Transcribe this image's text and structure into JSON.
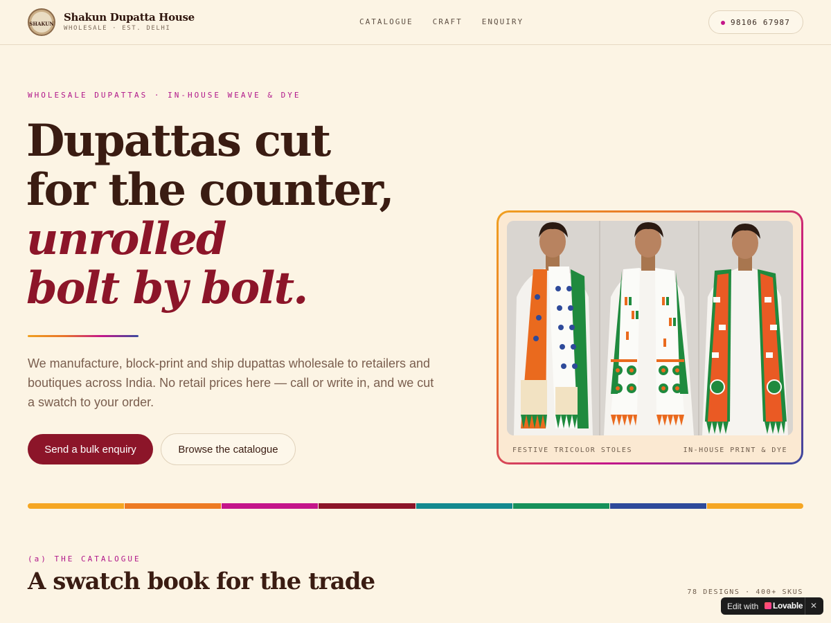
{
  "header": {
    "logo_text": "SHAKUN",
    "brand_name": "Shakun Dupatta House",
    "brand_tagline": "WHOLESALE · EST. DELHI",
    "nav": [
      {
        "label": "CATALOGUE"
      },
      {
        "label": "CRAFT"
      },
      {
        "label": "ENQUIRY"
      }
    ],
    "phone": "98106 67987"
  },
  "hero": {
    "eyebrow": "WHOLESALE DUPATTAS · IN-HOUSE WEAVE & DYE",
    "headline_lines": [
      "Dupattas cut",
      "for the counter,",
      "unrolled",
      "bolt by bolt."
    ],
    "lede": "We manufacture, block-print and ship dupattas wholesale to retailers and boutiques across India. No retail prices here — call or write in, and we cut a swatch to your order.",
    "primary_cta": "Send a bulk enquiry",
    "secondary_cta": "Browse the catalogue",
    "image_caption_left": "FESTIVE TRICOLOR STOLES",
    "image_caption_right": "IN-HOUSE PRINT & DYE"
  },
  "palette_strip": [
    "#f5a623",
    "#ed7a22",
    "#c4158a",
    "#8c1529",
    "#138a8f",
    "#16915a",
    "#2e4a9a",
    "#f5a623"
  ],
  "catalogue": {
    "eyebrow": "(a) THE CATALOGUE",
    "title": "A swatch book for the trade",
    "meta": "78 DESIGNS · 400+ SKUS"
  },
  "badge": {
    "label": "Edit with",
    "brand": "Lovable",
    "close": "✕"
  },
  "colors": {
    "background": "#fcf4e4",
    "ink": "#3a1c12",
    "accent": "#8c1529",
    "magenta": "#c4158a"
  }
}
